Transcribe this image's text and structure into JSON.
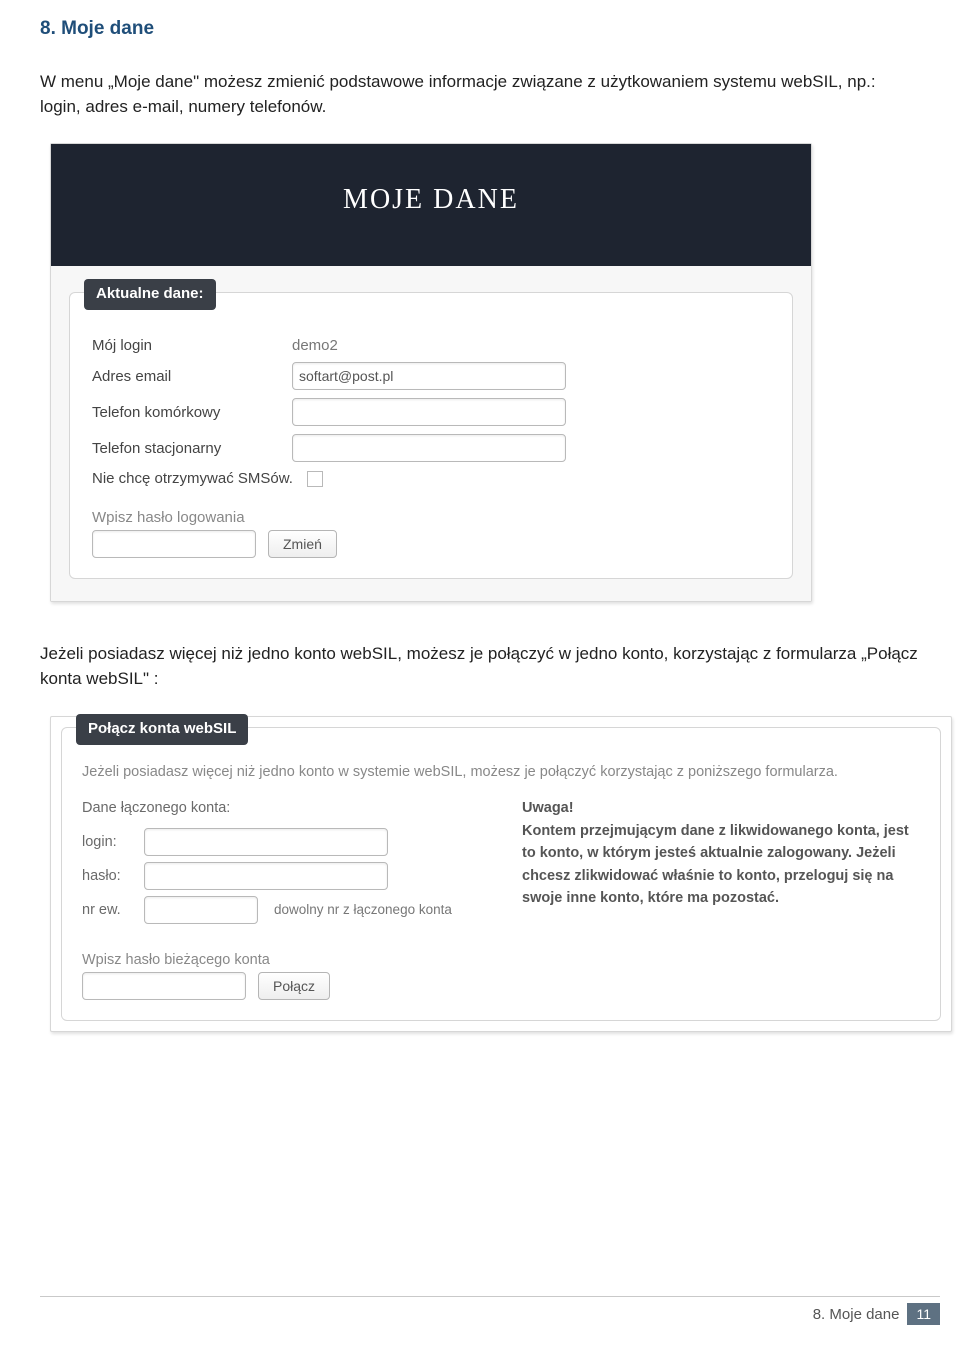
{
  "heading": "8. Moje dane",
  "intro": "W menu „Moje dane\" możesz zmienić podstawowe informacje związane z użytkowaniem systemu webSIL, np.: login, adres e-mail, numery telefonów.",
  "panel1": {
    "header": "MOJE DANE",
    "legend": "Aktualne dane:",
    "login_label": "Mój login",
    "login_value": "demo2",
    "email_label": "Adres email",
    "email_value": "softart@post.pl",
    "mobile_label": "Telefon komórkowy",
    "mobile_value": "",
    "landline_label": "Telefon stacjonarny",
    "landline_value": "",
    "nosms_label": "Nie chcę otrzymywać SMSów.",
    "password_label": "Wpisz hasło logowania",
    "button": "Zmień"
  },
  "mid_text": "Jeżeli posiadasz więcej niż jedno konto webSIL, możesz je połączyć w jedno konto, korzystając z formularza „Połącz konta webSIL\" :",
  "panel2": {
    "legend": "Połącz konta webSIL",
    "desc": "Jeżeli posiadasz więcej niż jedno konto w systemie webSIL, możesz je połączyć korzystając z poniższego formularza.",
    "left_head": "Dane łączonego konta:",
    "login_label": "login:",
    "pass_label": "hasło:",
    "nrew_label": "nr ew.",
    "nrew_hint": "dowolny nr z łączonego konta",
    "warn_head": "Uwaga!",
    "warn_body": "Kontem przejmującym dane z likwidowanego konta, jest to konto, w którym jesteś aktualnie zalogowany. Jeżeli chcesz zlikwidować właśnie to konto, przeloguj się na swoje inne konto, które ma pozostać.",
    "current_pass_label": "Wpisz hasło bieżącego konta",
    "button": "Połącz"
  },
  "footer": {
    "section": "8. Moje dane",
    "page": "11"
  }
}
